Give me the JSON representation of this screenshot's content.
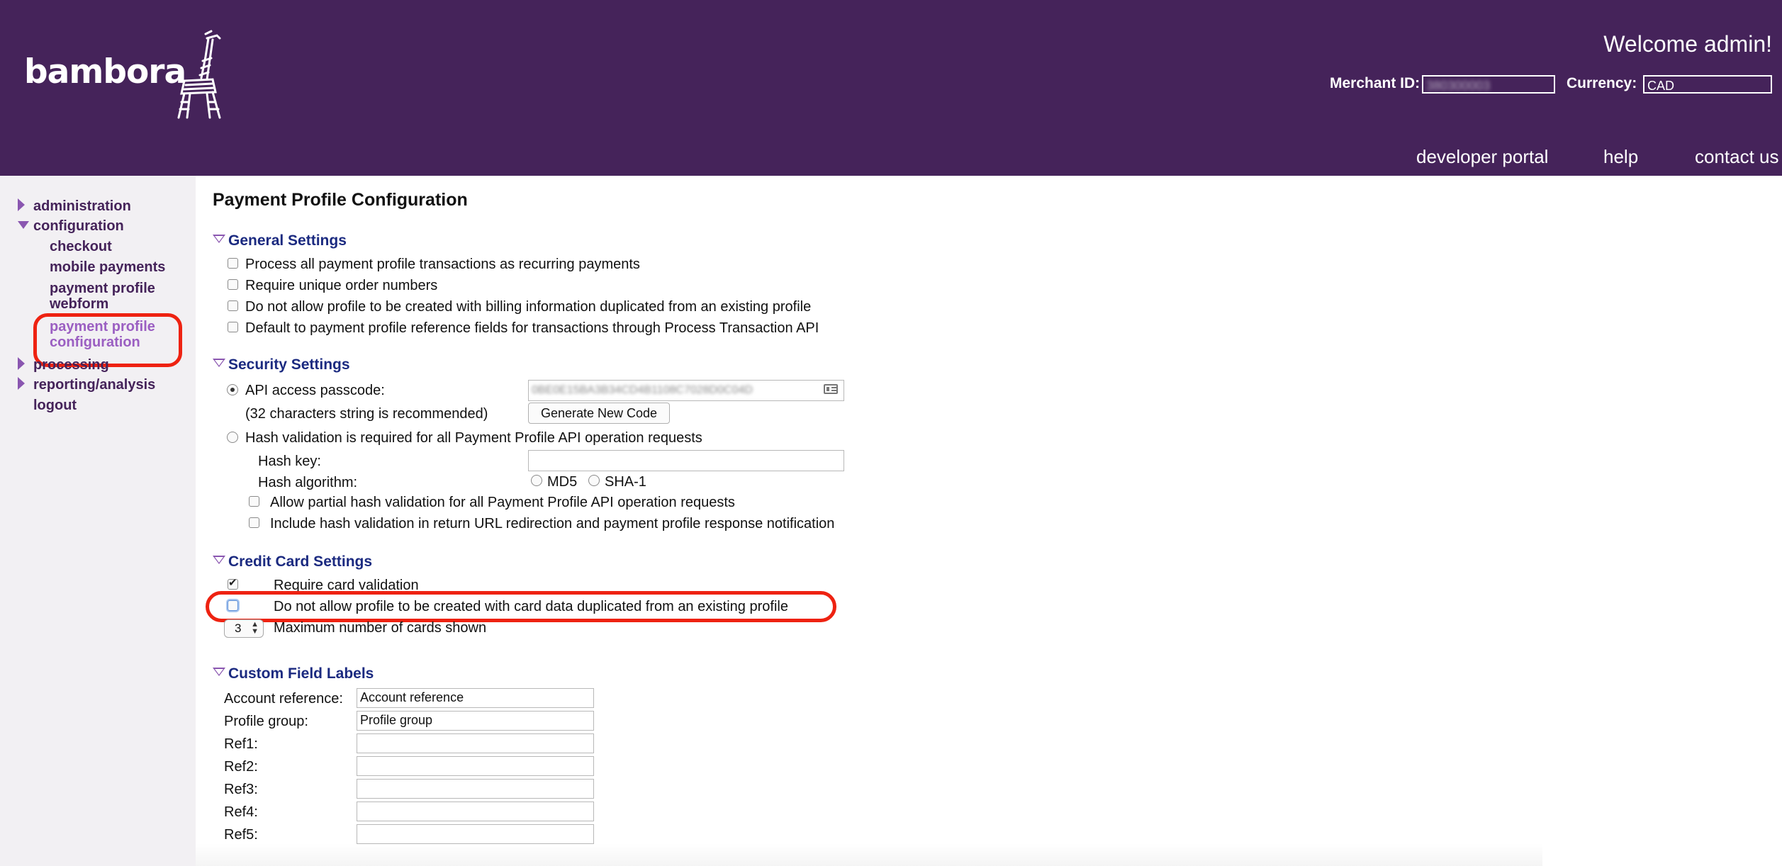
{
  "header": {
    "logo_text": "bambora",
    "welcome": "Welcome admin!",
    "merchant_id_label": "Merchant ID:",
    "merchant_id_value": "380300003",
    "currency_label": "Currency:",
    "currency_value": "CAD",
    "links": [
      "developer portal",
      "help",
      "contact us"
    ]
  },
  "sidebar": {
    "administration": "administration",
    "configuration": "configuration",
    "checkout": "checkout",
    "mobile_payments": "mobile payments",
    "payment_profile_webform_1": "payment profile",
    "payment_profile_webform_2": "webform",
    "payment_profile_configuration_1": "payment profile",
    "payment_profile_configuration_2": "configuration",
    "processing": "processing",
    "reporting_analysis": "reporting/analysis",
    "logout": "logout"
  },
  "page_title": "Payment Profile Configuration",
  "general": {
    "heading": "General Settings",
    "options": [
      "Process all payment profile transactions as recurring payments",
      "Require unique order numbers",
      "Do not allow profile to be created with billing information duplicated from an existing profile",
      "Default to payment profile reference fields for transactions through Process Transaction API"
    ]
  },
  "security": {
    "heading": "Security Settings",
    "api_passcode_label": "API access passcode:",
    "api_passcode_note": "(32 characters string is recommended)",
    "api_passcode_value": "0BE0E15BA3B34CD4B1108C7028D0C04D",
    "generate_button": "Generate New Code",
    "hash_validation_label": "Hash validation is required for all Payment Profile API operation requests",
    "hash_key_label": "Hash key:",
    "hash_algorithm_label": "Hash algorithm:",
    "md5": "MD5",
    "sha1": "SHA-1",
    "allow_partial": "Allow partial hash validation for all Payment Profile API operation requests",
    "include_hash": "Include hash validation in return URL redirection and payment profile response notification"
  },
  "credit_card": {
    "heading": "Credit Card Settings",
    "require_validation": "Require card validation",
    "no_duplicate": "Do not allow profile to be created with card data duplicated from an existing profile",
    "max_cards_value": "3",
    "max_cards_label": "Maximum number of cards shown"
  },
  "custom_fields": {
    "heading": "Custom Field Labels",
    "account_reference_label": "Account reference:",
    "account_reference_value": "Account reference",
    "profile_group_label": "Profile group:",
    "profile_group_value": "Profile group",
    "ref1": "Ref1:",
    "ref2": "Ref2:",
    "ref3": "Ref3:",
    "ref4": "Ref4:",
    "ref5": "Ref5:"
  },
  "colors": {
    "header_bg": "#45235a",
    "accent": "#8a56b0",
    "section_heading": "#1b2a80",
    "highlight": "#ee2211"
  }
}
